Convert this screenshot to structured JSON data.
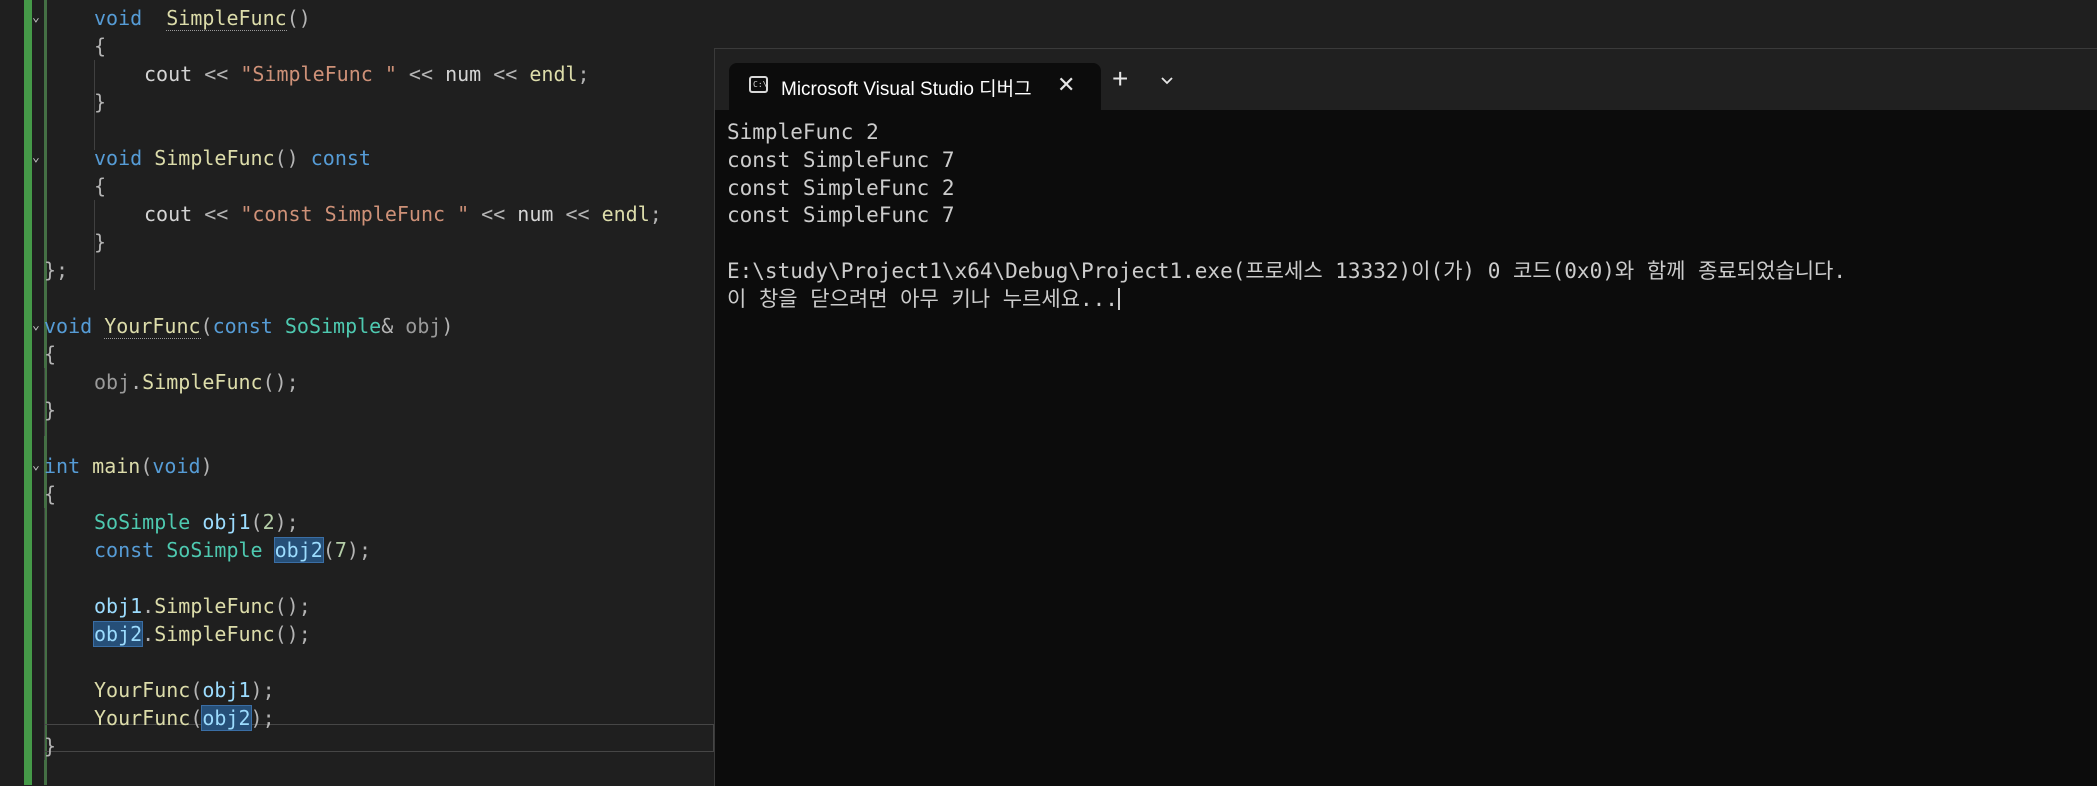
{
  "editor": {
    "lines": [
      {
        "segments": [
          [
            "kw",
            "void"
          ],
          [
            "",
            "  "
          ],
          [
            "fn squig",
            "SimpleFunc"
          ],
          [
            "op",
            "()"
          ]
        ]
      },
      {
        "segments": [
          [
            "op",
            "{"
          ]
        ]
      },
      {
        "segments": [
          [
            "",
            "cout "
          ],
          [
            "op",
            "<< "
          ],
          [
            "st",
            "\"SimpleFunc \""
          ],
          [
            "op",
            " << "
          ],
          [
            "",
            "num "
          ],
          [
            "op",
            "<< "
          ],
          [
            "fn",
            "endl"
          ],
          [
            "op",
            ";"
          ]
        ]
      },
      {
        "segments": [
          [
            "op",
            "}"
          ]
        ]
      },
      {
        "segments": []
      },
      {
        "segments": [
          [
            "kw",
            "void"
          ],
          [
            "",
            " "
          ],
          [
            "fn",
            "SimpleFunc"
          ],
          [
            "op",
            "() "
          ],
          [
            "kw",
            "const"
          ]
        ]
      },
      {
        "segments": [
          [
            "op",
            "{"
          ]
        ]
      },
      {
        "segments": [
          [
            "",
            "cout "
          ],
          [
            "op",
            "<< "
          ],
          [
            "st",
            "\"const SimpleFunc \""
          ],
          [
            "op",
            " << "
          ],
          [
            "",
            "num "
          ],
          [
            "op",
            "<< "
          ],
          [
            "fn",
            "endl"
          ],
          [
            "op",
            ";"
          ]
        ]
      },
      {
        "segments": [
          [
            "op",
            "}"
          ]
        ]
      },
      {
        "segments": [
          [
            "op",
            "};"
          ]
        ]
      },
      {
        "segments": []
      },
      {
        "segments": [
          [
            "kw",
            "void"
          ],
          [
            "",
            " "
          ],
          [
            "fn squig",
            "YourFunc"
          ],
          [
            "op",
            "("
          ],
          [
            "kw",
            "const"
          ],
          [
            "",
            " "
          ],
          [
            "ty",
            "SoSimple"
          ],
          [
            "op",
            "& "
          ],
          [
            "mu",
            "obj"
          ],
          [
            "op",
            ")"
          ]
        ]
      },
      {
        "segments": [
          [
            "op",
            "{"
          ]
        ]
      },
      {
        "segments": [
          [
            "mu",
            "obj"
          ],
          [
            "op",
            "."
          ],
          [
            "fn",
            "SimpleFunc"
          ],
          [
            "op",
            "();"
          ]
        ]
      },
      {
        "segments": [
          [
            "op",
            "}"
          ]
        ]
      },
      {
        "segments": []
      },
      {
        "segments": [
          [
            "kw",
            "int"
          ],
          [
            "",
            " "
          ],
          [
            "fn",
            "main"
          ],
          [
            "op",
            "("
          ],
          [
            "kw",
            "void"
          ],
          [
            "op",
            ")"
          ]
        ]
      },
      {
        "segments": [
          [
            "op",
            "{"
          ]
        ]
      },
      {
        "segments": [
          [
            "ty",
            "SoSimple"
          ],
          [
            "",
            " "
          ],
          [
            "va",
            "obj1"
          ],
          [
            "op",
            "("
          ],
          [
            "nu",
            "2"
          ],
          [
            "op",
            ");"
          ]
        ]
      },
      {
        "segments": [
          [
            "kw",
            "const"
          ],
          [
            "",
            " "
          ],
          [
            "ty",
            "SoSimple"
          ],
          [
            "",
            " "
          ],
          [
            "va hl",
            "obj2"
          ],
          [
            "op",
            "("
          ],
          [
            "nu",
            "7"
          ],
          [
            "op",
            ");"
          ]
        ]
      },
      {
        "segments": []
      },
      {
        "segments": [
          [
            "va",
            "obj1"
          ],
          [
            "op",
            "."
          ],
          [
            "fn",
            "SimpleFunc"
          ],
          [
            "op",
            "();"
          ]
        ]
      },
      {
        "segments": [
          [
            "va hl",
            "obj2"
          ],
          [
            "op",
            "."
          ],
          [
            "fn",
            "SimpleFunc"
          ],
          [
            "op",
            "();"
          ]
        ]
      },
      {
        "segments": []
      },
      {
        "segments": [
          [
            "fn",
            "YourFunc"
          ],
          [
            "op",
            "("
          ],
          [
            "va",
            "obj1"
          ],
          [
            "op",
            ");"
          ]
        ]
      },
      {
        "segments": [
          [
            "fn",
            "YourFunc"
          ],
          [
            "op",
            "("
          ],
          [
            "va hl",
            "obj2"
          ],
          [
            "op",
            ");"
          ]
        ]
      },
      {
        "segments": [
          [
            "op",
            "}"
          ]
        ]
      }
    ]
  },
  "terminal": {
    "tab_title": "Microsoft Visual Studio 디버그",
    "tab_icon_text": "C:\\",
    "close_glyph": "✕",
    "new_tab_glyph": "+",
    "output": [
      "SimpleFunc 2",
      "const SimpleFunc 7",
      "const SimpleFunc 2",
      "const SimpleFunc 7",
      "",
      "E:\\study\\Project1\\x64\\Debug\\Project1.exe(프로세스 13332)이(가) 0 코드(0x0)와 함께 종료되었습니다.",
      "이 창을 닫으려면 아무 키나 누르세요..."
    ]
  }
}
